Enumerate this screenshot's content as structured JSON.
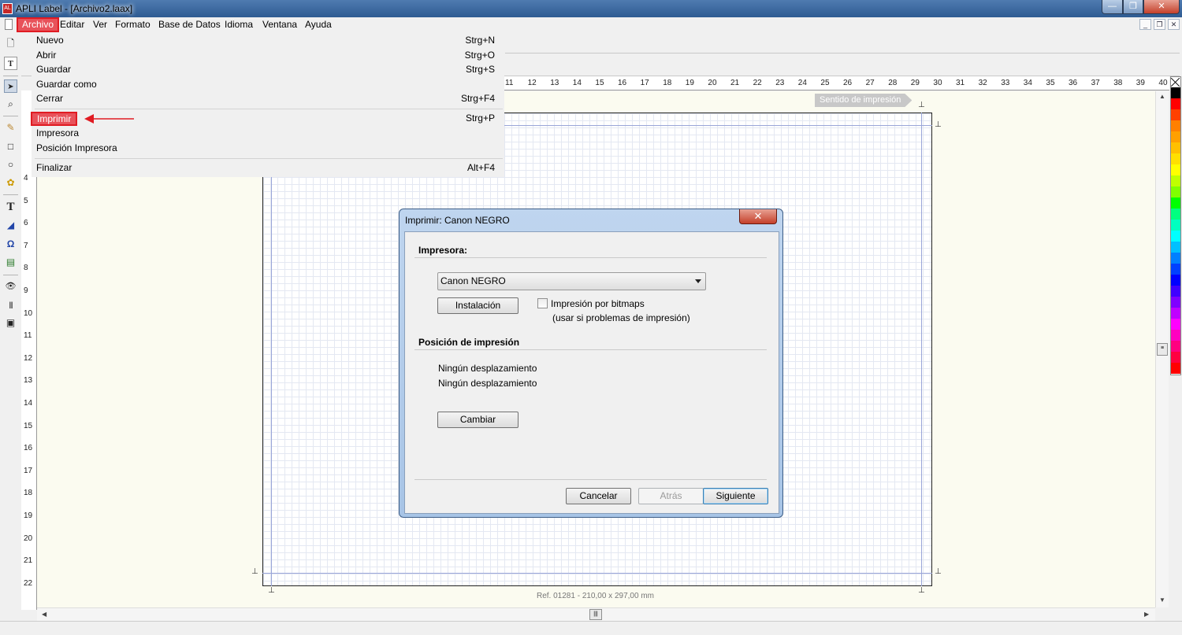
{
  "window": {
    "title": "APLI Label - [Archivo2.laax]",
    "controls": {
      "minimize": "—",
      "maximize": "❐",
      "close": "✕"
    }
  },
  "menubar": {
    "items": [
      {
        "label": "Archivo"
      },
      {
        "label": "Editar"
      },
      {
        "label": "Ver"
      },
      {
        "label": "Formato"
      },
      {
        "label": "Base de Datos"
      },
      {
        "label": "Idioma"
      },
      {
        "label": "Ventana"
      },
      {
        "label": "Ayuda"
      }
    ],
    "mdi_controls": {
      "minimize": "_",
      "restore": "❐",
      "close": "✕"
    }
  },
  "file_menu": {
    "items": [
      {
        "label": "Nuevo",
        "shortcut": "Strg+N"
      },
      {
        "label": "Abrir",
        "shortcut": "Strg+O"
      },
      {
        "label": "Guardar",
        "shortcut": "Strg+S"
      },
      {
        "label": "Guardar como",
        "shortcut": ""
      },
      {
        "label": "Cerrar",
        "shortcut": "Strg+F4"
      },
      {
        "label": "Imprimir",
        "shortcut": "Strg+P",
        "highlighted": true
      },
      {
        "label": "Impresora",
        "shortcut": ""
      },
      {
        "label": "Posición Impresora",
        "shortcut": ""
      },
      {
        "label": "Finalizar",
        "shortcut": "Alt+F4"
      }
    ],
    "highlight_color": "#e01b22"
  },
  "left_toolbar": {
    "tools": [
      {
        "icon": "new-document-icon",
        "glyph": "🗋"
      },
      {
        "icon": "text-tool-icon",
        "glyph": "T"
      },
      {
        "icon": "pointer-icon",
        "glyph": "➤"
      },
      {
        "icon": "zoom-icon",
        "glyph": "⌕"
      },
      {
        "icon": "pencil-icon",
        "glyph": "✎"
      },
      {
        "icon": "rectangle-icon",
        "glyph": "□"
      },
      {
        "icon": "ellipse-icon",
        "glyph": "○"
      },
      {
        "icon": "image-icon",
        "glyph": "✿"
      },
      {
        "icon": "text-icon",
        "glyph": "T"
      },
      {
        "icon": "rotated-text-icon",
        "glyph": "◢"
      },
      {
        "icon": "symbol-icon",
        "glyph": "Ω"
      },
      {
        "icon": "field-icon",
        "glyph": "▤"
      },
      {
        "icon": "preview-eye-icon",
        "glyph": "👁"
      },
      {
        "icon": "barcode-icon",
        "glyph": "|||"
      },
      {
        "icon": "frame-icon",
        "glyph": "▣"
      }
    ]
  },
  "ruler_top": [
    "11",
    "12",
    "13",
    "14",
    "15",
    "16",
    "17",
    "18",
    "19",
    "20",
    "21",
    "22",
    "23",
    "24",
    "25",
    "26",
    "27",
    "28",
    "29",
    "30",
    "31",
    "32",
    "33",
    "34",
    "35",
    "36",
    "37",
    "38",
    "39",
    "40"
  ],
  "ruler_left": [
    "4",
    "5",
    "6",
    "7",
    "8",
    "9",
    "10",
    "11",
    "12",
    "13",
    "14",
    "15",
    "16",
    "17",
    "18",
    "19",
    "20",
    "21",
    "22"
  ],
  "canvas": {
    "print_direction": "Sentido de impresión",
    "label_ref": "Ref. 01281 - 210,00 x 297,00 mm",
    "pin_glyph": "⊥"
  },
  "palette": [
    "#000000",
    "#ff0000",
    "#ff4000",
    "#ff8000",
    "#ffa000",
    "#ffc000",
    "#ffe000",
    "#ffff00",
    "#c0ff00",
    "#80ff00",
    "#00ff00",
    "#00ff80",
    "#00ffc0",
    "#00ffff",
    "#00c0ff",
    "#0080ff",
    "#0040ff",
    "#0000ff",
    "#4000ff",
    "#8000ff",
    "#c000ff",
    "#ff00ff",
    "#ff00c0",
    "#ff0080",
    "#ff0040",
    "#ff0000"
  ],
  "print_dialog": {
    "title": "Imprimir: Canon NEGRO",
    "printer_section": "Impresora:",
    "printer_selected": "Canon NEGRO",
    "setup_button": "Instalación",
    "bitmap_checkbox_label": "Impresión por bitmaps",
    "bitmap_checkbox_hint": "(usar si problemas de impresión)",
    "position_section": "Posición de impresión",
    "offset_line_1": "Ningún desplazamiento",
    "offset_line_2": "Ningún desplazamiento",
    "change_button": "Cambiar",
    "cancel_button": "Cancelar",
    "back_button": "Atrás",
    "next_button": "Siguiente",
    "close_glyph": "✕"
  }
}
